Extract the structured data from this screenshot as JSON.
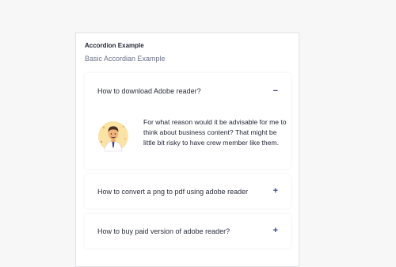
{
  "card": {
    "title": "Accordion Example",
    "subtitle": "Basic Accordian Example"
  },
  "accordion": {
    "items": [
      {
        "question": "How to download Adobe reader?",
        "expanded": true,
        "toggle": "−",
        "answer": "For what reason would it be advisable for me to think about business content? That might be little bit risky to have crew member like them."
      },
      {
        "question": "How to convert a png to pdf using adobe reader",
        "expanded": false,
        "toggle": "+"
      },
      {
        "question": "How to buy paid version of adobe reader?",
        "expanded": false,
        "toggle": "+"
      }
    ]
  },
  "colors": {
    "accent": "#3a3f8f",
    "subtitle": "#6b7289",
    "background": "#f7f7f8"
  }
}
